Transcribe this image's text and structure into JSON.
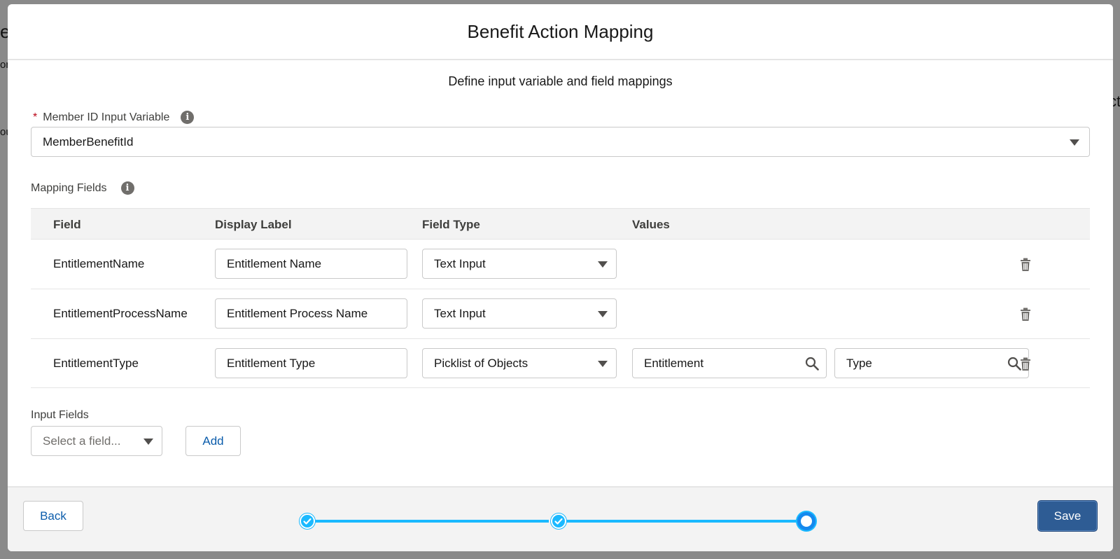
{
  "background": {
    "fragment_left_top": "e",
    "fragment_left_mid": "on",
    "fragment_left_bottom": "ou",
    "fragment_right_top": "ct"
  },
  "modal": {
    "title": "Benefit Action Mapping",
    "subtitle": "Define input variable and field mappings"
  },
  "member_id": {
    "required_marker": "*",
    "label": "Member ID Input Variable",
    "info_icon": "info-icon",
    "value": "MemberBenefitId"
  },
  "mapping": {
    "label": "Mapping Fields",
    "info_icon": "info-icon",
    "columns": [
      "Field",
      "Display Label",
      "Field Type",
      "Values"
    ],
    "rows": [
      {
        "field": "EntitlementName",
        "display_label": "Entitlement Name",
        "field_type": "Text Input"
      },
      {
        "field": "EntitlementProcessName",
        "display_label": "Entitlement Process Name",
        "field_type": "Text Input"
      },
      {
        "field": "EntitlementType",
        "display_label": "Entitlement Type",
        "field_type": "Picklist of Objects",
        "value_object": "Entitlement",
        "value_field": "Type"
      }
    ]
  },
  "input_fields": {
    "label": "Input Fields",
    "placeholder": "Select a field...",
    "add_label": "Add"
  },
  "footer": {
    "back_label": "Back",
    "save_label": "Save",
    "steps": [
      "complete",
      "complete",
      "current"
    ]
  },
  "colors": {
    "accent": "#0b5cab",
    "save_bg": "#2e5c94",
    "progress": "#1ab9ff",
    "required": "#ba0517"
  }
}
